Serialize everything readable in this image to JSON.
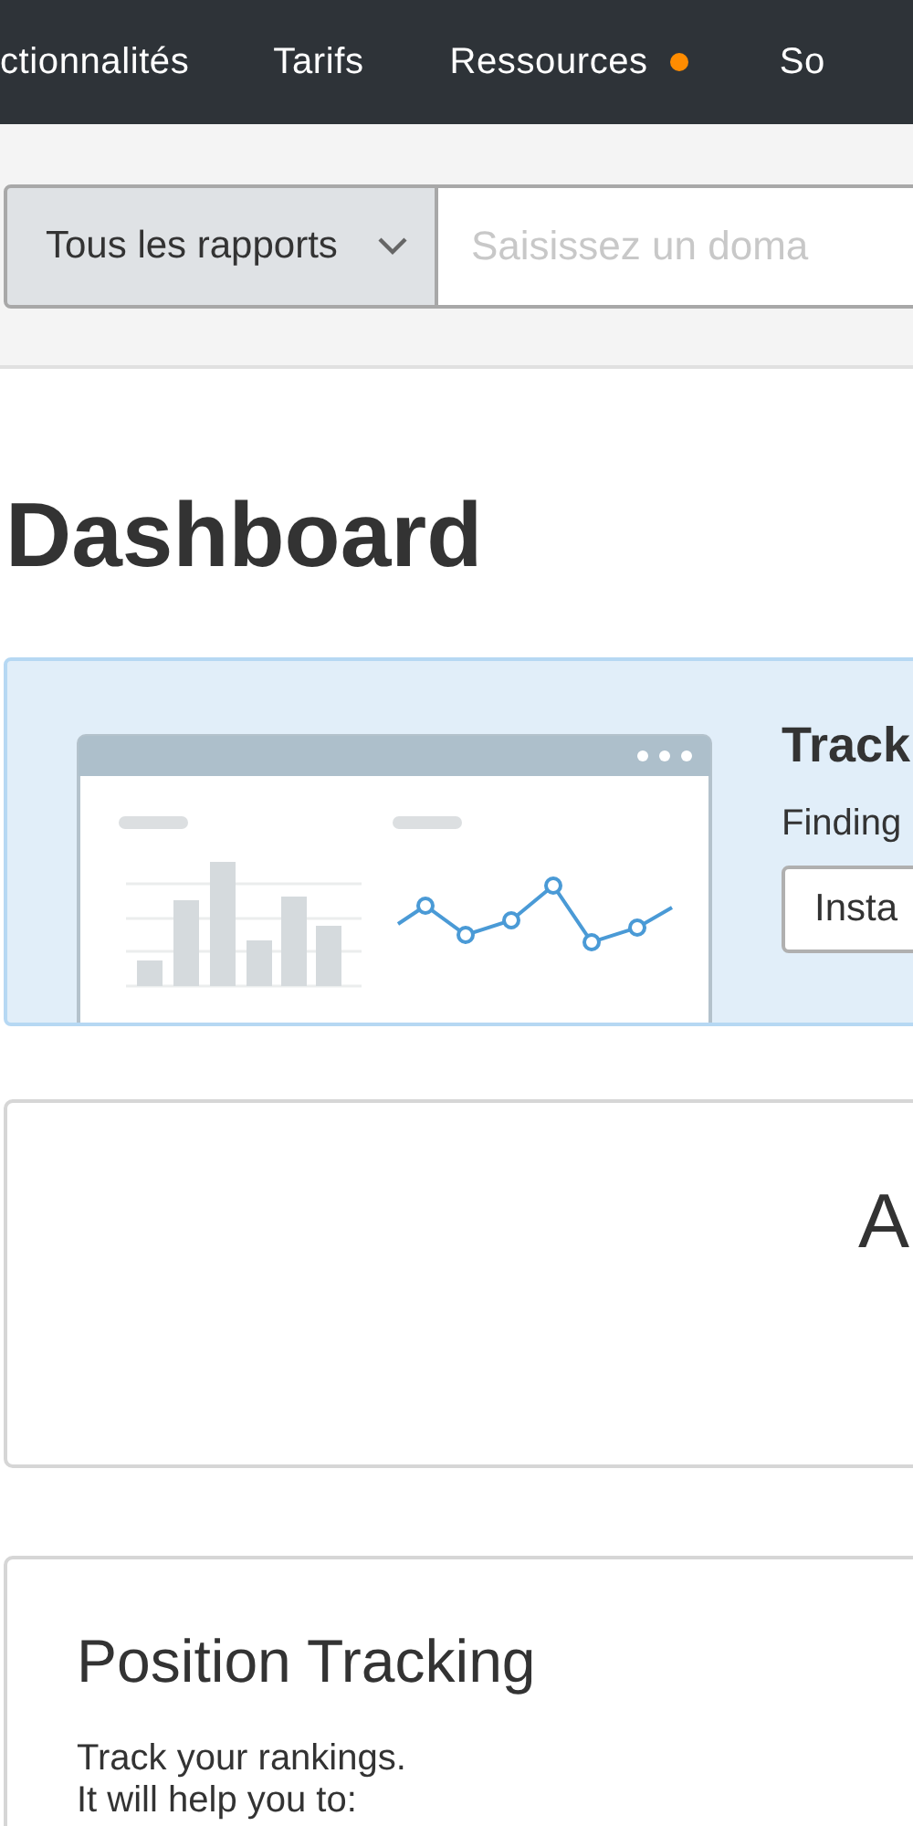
{
  "nav": {
    "items": [
      {
        "label": "ctionnalités",
        "has_dot": false
      },
      {
        "label": "Tarifs",
        "has_dot": false
      },
      {
        "label": "Ressources",
        "has_dot": true
      },
      {
        "label": "So",
        "has_dot": false
      }
    ]
  },
  "search": {
    "report_select": "Tous les rapports",
    "placeholder": "Saisissez un doma"
  },
  "page_title": "Dashboard",
  "banner": {
    "title": "Track",
    "text": "Finding",
    "button": "Insta"
  },
  "card_1": {
    "title": "A"
  },
  "card_2": {
    "title": "Position Tracking",
    "lines": [
      "Track your rankings.",
      "It will help you to:"
    ]
  }
}
